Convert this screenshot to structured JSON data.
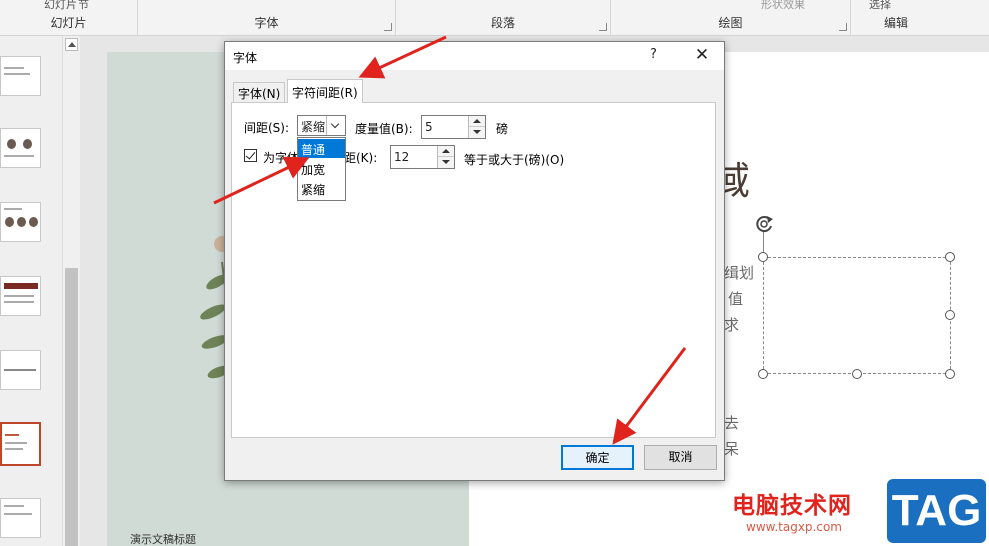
{
  "ribbon": {
    "groups": [
      {
        "label": "幻灯片",
        "top_items": [
          "幻灯片",
          "节"
        ]
      },
      {
        "label": "字体"
      },
      {
        "label": "段落"
      },
      {
        "label": "绘图",
        "top_items": [
          "形状效果"
        ]
      },
      {
        "label": "编辑",
        "top_items": [
          "选择"
        ]
      }
    ]
  },
  "slide": {
    "caption": "演示文稿标题",
    "title_fragment": "域",
    "body_fragments": [
      "缉划",
      "值",
      "求",
      "去",
      "呆"
    ]
  },
  "dialog": {
    "title": "字体",
    "help": "?",
    "close": "✕",
    "tabs": [
      {
        "label": "字体(N)",
        "active": false
      },
      {
        "label": "字符间距(R)",
        "active": true
      }
    ],
    "spacing_label": "间距(S):",
    "spacing_value": "紧缩",
    "measure_label": "度量值(B):",
    "measure_value": "5",
    "measure_unit": "磅",
    "kerning_label_a": "为字体",
    "kerning_label_b": "距(K):",
    "kerning_value": "12",
    "kerning_suffix": "等于或大于(磅)(O)",
    "kerning_checked": true,
    "dropdown_options": [
      "普通",
      "加宽",
      "紧缩"
    ],
    "dropdown_highlighted": "普通",
    "ok_label": "确定",
    "cancel_label": "取消"
  },
  "watermark": {
    "text": "电脑技术网",
    "url": "www.tagxp.com",
    "logo": "TAG"
  },
  "colors": {
    "accent": "#0078d7",
    "arrow": "#e0231c",
    "selected_thumb": "#c0452b"
  }
}
